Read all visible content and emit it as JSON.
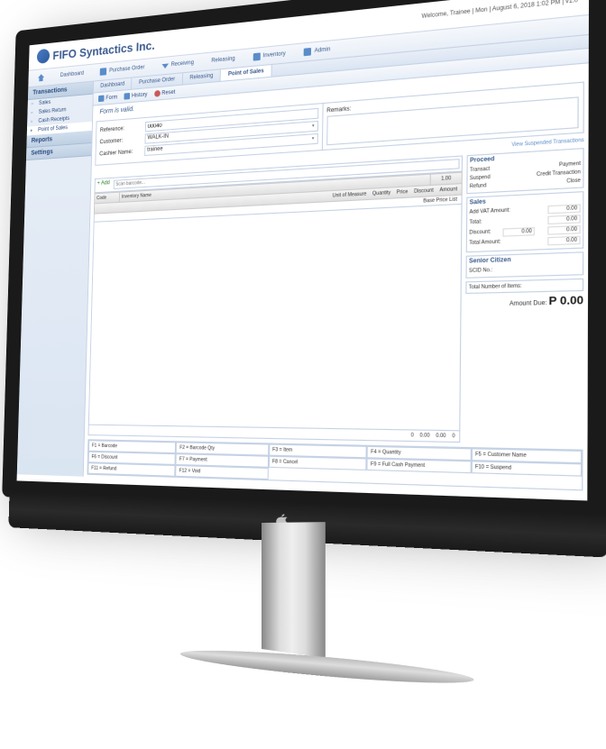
{
  "brand": {
    "name": "FIFO Syntactics Inc."
  },
  "welcome": "Welcome, Trainee | Mon | August 6, 2018 1:02 PM | v1.0",
  "nav": {
    "dashboard": "Dashboard",
    "purchase_order": "Purchase Order",
    "receiving": "Receiving",
    "releasing": "Releasing",
    "inventory": "Inventory",
    "admin": "Admin"
  },
  "sidebar": {
    "transactions": "Transactions",
    "items": {
      "sales": "Sales",
      "sales_return": "Sales Return",
      "cash_receipts": "Cash Receipts",
      "pos": "Point of Sales"
    },
    "reports": "Reports",
    "settings": "Settings"
  },
  "tabs": {
    "dashboard": "Dashboard",
    "purchase_order": "Purchase Order",
    "releasing": "Releasing",
    "pos": "Point of Sales"
  },
  "toolbar": {
    "form": "Form",
    "history": "History",
    "reset": "Reset"
  },
  "form_status": "Form is valid.",
  "form": {
    "reference_label": "Reference:",
    "reference_value": "00040",
    "customer_label": "Customer:",
    "customer_value": "WALK-IN",
    "cashier_label": "Cashier Name:",
    "cashier_value": "trainee",
    "remarks_label": "Remarks:"
  },
  "suspended_link": "View Suspended Transactions",
  "grid": {
    "add": "+ Add",
    "scan_placeholder": "Scan barcode...",
    "headers": {
      "code": "Code",
      "name": "Inventory Name",
      "qty": "1.00",
      "uom": "Unit of Measure",
      "quantity": "Quantity",
      "price": "Price",
      "discount": "Discount",
      "amount": "Amount"
    },
    "pricelist": "Base Price List",
    "totals": {
      "zero": "0",
      "zeroamt": "0.00"
    }
  },
  "proceed": {
    "title": "Proceed",
    "transact": "Transact",
    "suspend": "Suspend",
    "refund": "Refund",
    "payment": "Payment",
    "credit": "Credit Transaction",
    "close": "Close"
  },
  "sales": {
    "title": "Sales",
    "add_vat": "Add VAT Amount:",
    "total": "Total:",
    "discount": "Discount:",
    "discount_val": "0.00",
    "total_amount": "Total Amount:",
    "val": "0.00"
  },
  "senior": {
    "title": "Senior Citizen",
    "scid": "SCID No.:"
  },
  "items_count": {
    "label": "Total Number of Items:"
  },
  "amount_due": {
    "label": "Amount Due:",
    "value": "P 0.00"
  },
  "shortcuts": {
    "f1": "F1 = Barcode",
    "f2": "F2 = Barcode Qty",
    "f3": "F3 = Item",
    "f4": "F4 = Quantity",
    "f5": "F5 = Customer Name",
    "f6": "F6 = Discount",
    "f7": "F7 = Payment",
    "f8": "F8 = Cancel",
    "f9": "F9 = Full Cash Payment",
    "f10": "F10 = Suspend",
    "f11": "F11 = Refund",
    "f12": "F12 = Void"
  }
}
